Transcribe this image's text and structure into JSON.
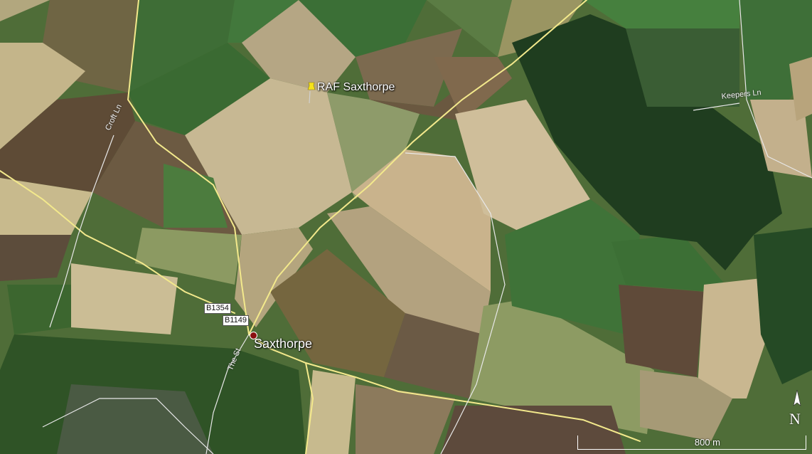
{
  "map": {
    "imagery": "satellite",
    "placemarks": {
      "raf": "RAF Saxthorpe",
      "village": "Saxthorpe"
    },
    "road_labels": {
      "croft": "Croft Ln",
      "the_street": "The St",
      "keepers": "Keepers Ln"
    },
    "shields": {
      "b1354": "B1354",
      "b1149": "B1149"
    },
    "compass": "N",
    "scale": "800 m",
    "colors": {
      "road": "#f3e98c",
      "pin": "#f5e21b",
      "place_dot": "#8a1010"
    }
  }
}
